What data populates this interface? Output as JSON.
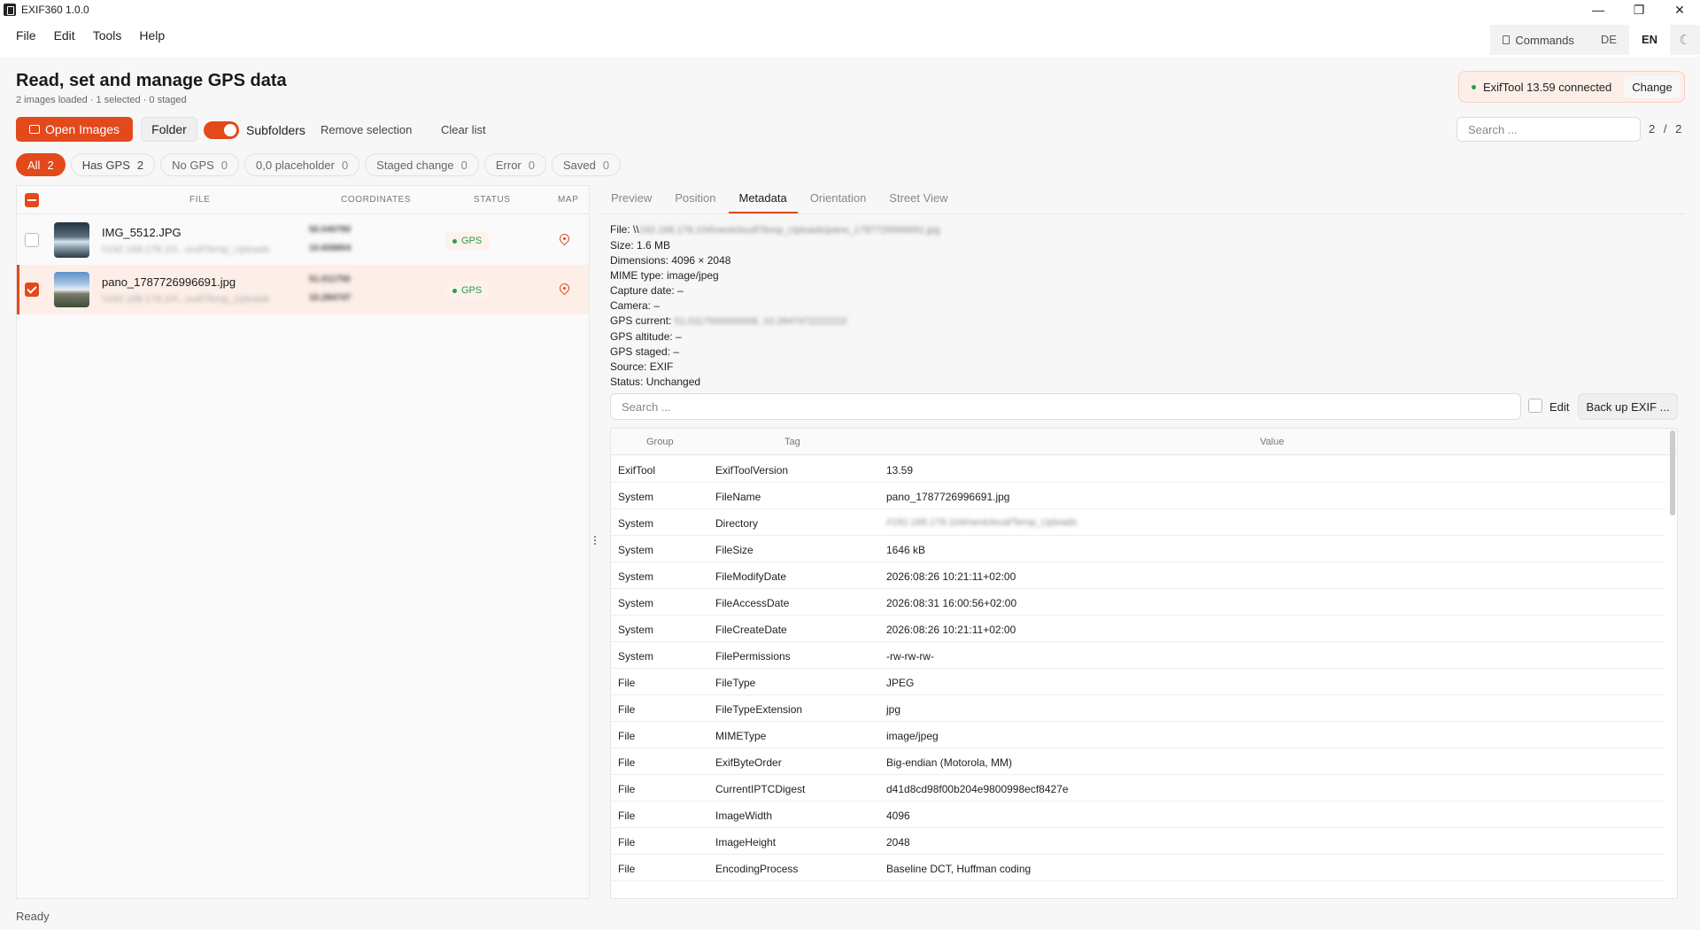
{
  "window": {
    "title": "EXIF360 1.0.0",
    "minimize": "—",
    "maximize": "❐",
    "close": "✕"
  },
  "menu": [
    "File",
    "Edit",
    "Tools",
    "Help"
  ],
  "top_right": {
    "commands": "Commands",
    "lang_de": "DE",
    "lang_en": "EN",
    "theme_icon": "☾"
  },
  "header": {
    "title": "Read, set and manage GPS data",
    "subtitle": "2 images loaded · 1 selected · 0 staged",
    "exiftool_status": "ExifTool 13.59 connected",
    "change_label": "Change"
  },
  "toolbar": {
    "open_images": "Open Images",
    "folder": "Folder",
    "subfolders": "Subfolders",
    "remove_selection": "Remove selection",
    "clear_list": "Clear list",
    "search_placeholder": "Search ...",
    "pager": "2 / 2"
  },
  "filters": [
    {
      "label": "All",
      "count": "2"
    },
    {
      "label": "Has GPS",
      "count": "2"
    },
    {
      "label": "No GPS",
      "count": "0"
    },
    {
      "label": "0,0 placeholder",
      "count": "0"
    },
    {
      "label": "Staged change",
      "count": "0"
    },
    {
      "label": "Error",
      "count": "0"
    },
    {
      "label": "Saved",
      "count": "0"
    }
  ],
  "file_list": {
    "columns": {
      "file": "FILE",
      "coordinates": "COORDINATES",
      "status": "STATUS",
      "map": "MAP"
    },
    "rows": [
      {
        "name": "IMG_5512.JPG",
        "path": "\\\\192.168.178.10\\...oud\\Temp_Uploads",
        "lat": "50.040780",
        "lon": "10.659804",
        "status": "GPS",
        "selected": false
      },
      {
        "name": "pano_1787726996691.jpg",
        "path": "\\\\192.168.178.10\\...oud\\Temp_Uploads",
        "lat": "51.011750",
        "lon": "10.284747",
        "status": "GPS",
        "selected": true
      }
    ]
  },
  "tabs": [
    "Preview",
    "Position",
    "Metadata",
    "Orientation",
    "Street View"
  ],
  "active_tab": "Metadata",
  "file_info": {
    "file_label": "File: \\\\",
    "file_path": "192.168.178.104\\nextcloud\\Temp_Uploads\\pano_1787726996691.jpg",
    "size": "Size: 1.6 MB",
    "dimensions": "Dimensions: 4096 × 2048",
    "mime": "MIME type: image/jpeg",
    "capture_date": "Capture date: –",
    "camera": "Camera: –",
    "gps_current_label": "GPS current:",
    "gps_current_value": "51.0117500000006, 10.2847472222222",
    "gps_altitude": "GPS altitude: –",
    "gps_staged": "GPS staged: –",
    "source": "Source: EXIF",
    "status": "Status: Unchanged"
  },
  "metadata": {
    "search_placeholder": "Search ...",
    "edit_label": "Edit",
    "backup_label": "Back up EXIF ...",
    "columns": {
      "group": "Group",
      "tag": "Tag",
      "value": "Value"
    },
    "rows": [
      {
        "group": "ExifTool",
        "tag": "ExifToolVersion",
        "value": "13.59"
      },
      {
        "group": "System",
        "tag": "FileName",
        "value": "pano_1787726996691.jpg"
      },
      {
        "group": "System",
        "tag": "Directory",
        "value": "//192.168.178.104/nextcloud/Temp_Uploads",
        "blurred": true
      },
      {
        "group": "System",
        "tag": "FileSize",
        "value": "1646 kB"
      },
      {
        "group": "System",
        "tag": "FileModifyDate",
        "value": "2026:08:26 10:21:11+02:00"
      },
      {
        "group": "System",
        "tag": "FileAccessDate",
        "value": "2026:08:31 16:00:56+02:00"
      },
      {
        "group": "System",
        "tag": "FileCreateDate",
        "value": "2026:08:26 10:21:11+02:00"
      },
      {
        "group": "System",
        "tag": "FilePermissions",
        "value": "-rw-rw-rw-"
      },
      {
        "group": "File",
        "tag": "FileType",
        "value": "JPEG"
      },
      {
        "group": "File",
        "tag": "FileTypeExtension",
        "value": "jpg"
      },
      {
        "group": "File",
        "tag": "MIMEType",
        "value": "image/jpeg"
      },
      {
        "group": "File",
        "tag": "ExifByteOrder",
        "value": "Big-endian (Motorola, MM)"
      },
      {
        "group": "File",
        "tag": "CurrentIPTCDigest",
        "value": "d41d8cd98f00b204e9800998ecf8427e"
      },
      {
        "group": "File",
        "tag": "ImageWidth",
        "value": "4096"
      },
      {
        "group": "File",
        "tag": "ImageHeight",
        "value": "2048"
      },
      {
        "group": "File",
        "tag": "EncodingProcess",
        "value": "Baseline DCT, Huffman coding"
      }
    ]
  },
  "status_bar": "Ready"
}
